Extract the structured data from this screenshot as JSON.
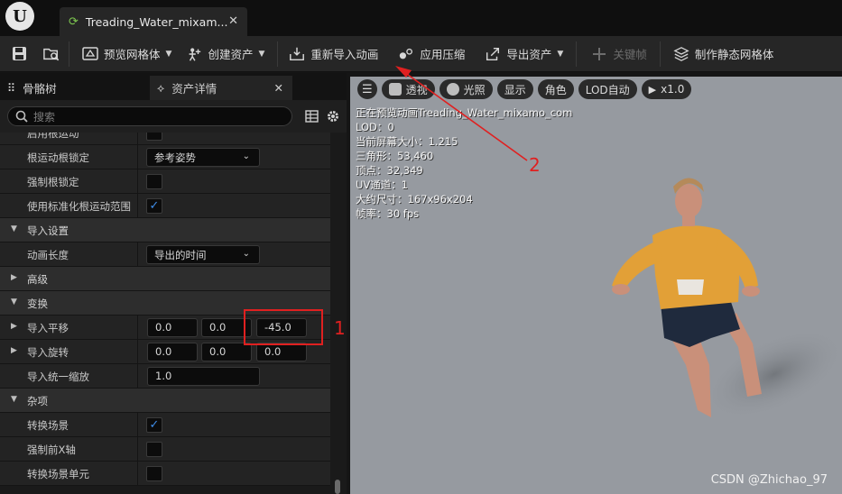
{
  "window": {
    "tab_title": "Treading_Water_mixamo_com",
    "tab_title_display": "Treading_Water_mixam...",
    "close_glyph": "✕"
  },
  "toolbar": {
    "preview_mesh": "预览网格体",
    "create_asset": "创建资产",
    "reimport_animation": "重新导入动画",
    "apply_compression": "应用压缩",
    "export_asset": "导出资产",
    "keyframe": "关键帧",
    "make_static_mesh": "制作静态网格体"
  },
  "panel": {
    "tab_skeleton": "骨骼树",
    "tab_asset_details": "资产详情",
    "search_placeholder": "搜索"
  },
  "properties": [
    {
      "type": "partial",
      "label": "启用根运动",
      "value": "checkbox_off"
    },
    {
      "type": "combo",
      "label": "根运动根锁定",
      "value": "参考姿势"
    },
    {
      "type": "checkbox",
      "label": "强制根锁定",
      "checked": false
    },
    {
      "type": "checkbox",
      "label": "使用标准化根运动范围",
      "checked": true
    },
    {
      "type": "category",
      "label": "导入设置",
      "expanded": true
    },
    {
      "type": "combo",
      "label": "动画长度",
      "value": "导出的时间"
    },
    {
      "type": "category",
      "label": "高级",
      "expanded": false
    },
    {
      "type": "category",
      "label": "变换",
      "expanded": true
    },
    {
      "type": "vector",
      "label": "导入平移",
      "values": [
        "0.0",
        "0.0",
        "-45.0"
      ]
    },
    {
      "type": "vector",
      "label": "导入旋转",
      "values": [
        "0.0",
        "0.0",
        "0.0"
      ]
    },
    {
      "type": "number",
      "label": "导入统一缩放",
      "value": "1.0"
    },
    {
      "type": "category",
      "label": "杂项",
      "expanded": true
    },
    {
      "type": "checkbox",
      "label": "转换场景",
      "checked": true
    },
    {
      "type": "checkbox",
      "label": "强制前X轴",
      "checked": false
    },
    {
      "type": "checkbox",
      "label": "转换场景单元",
      "checked": false
    }
  ],
  "viewport": {
    "buttons": {
      "menu": "",
      "perspective": "透视",
      "lit": "光照",
      "show": "显示",
      "character": "角色",
      "lod": "LOD自动",
      "play_speed": "x1.0"
    },
    "stats": [
      "正在预览动画Treading_Water_mixamo_com",
      "LOD：0",
      "当前屏幕大小：1.215",
      "三角形：53,460",
      "顶点：32,349",
      "UV通道：1",
      "大约尺寸：167x96x204",
      "帧率：30 fps"
    ],
    "watermark": "CSDN @Zhichao_97"
  },
  "annotations": {
    "label_1": "1",
    "label_2": "2",
    "color": "#e02020"
  },
  "colors": {
    "accent_blue": "#3f8de8",
    "viewport_bg": "#969aa0"
  }
}
